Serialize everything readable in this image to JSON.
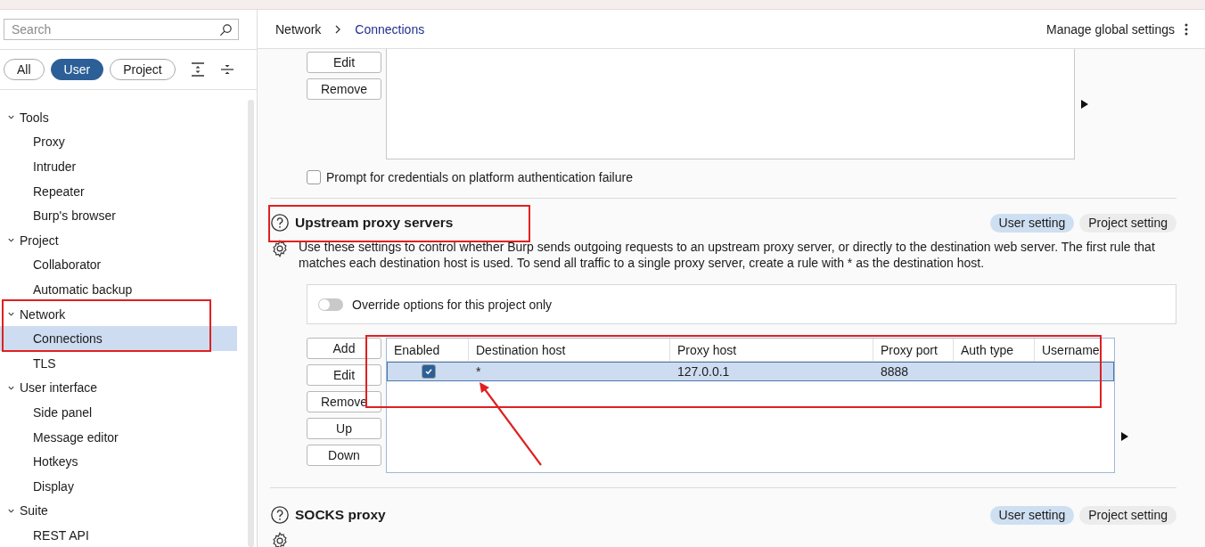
{
  "sidebar": {
    "search": {
      "placeholder": "Search"
    },
    "filters": [
      {
        "label": "All",
        "selected": false
      },
      {
        "label": "User",
        "selected": true
      },
      {
        "label": "Project",
        "selected": false
      }
    ],
    "tree": [
      {
        "label": "Tools",
        "expanded": true,
        "selected": false,
        "children": [
          {
            "label": "Proxy",
            "selected": false
          },
          {
            "label": "Intruder",
            "selected": false
          },
          {
            "label": "Repeater",
            "selected": false
          },
          {
            "label": "Burp's browser",
            "selected": false
          }
        ]
      },
      {
        "label": "Project",
        "expanded": true,
        "selected": false,
        "children": [
          {
            "label": "Collaborator",
            "selected": false
          },
          {
            "label": "Automatic backup",
            "selected": false
          }
        ]
      },
      {
        "label": "Network",
        "expanded": true,
        "selected": false,
        "children": [
          {
            "label": "Connections",
            "selected": true
          },
          {
            "label": "TLS",
            "selected": false
          }
        ]
      },
      {
        "label": "User interface",
        "expanded": true,
        "selected": false,
        "children": [
          {
            "label": "Side panel",
            "selected": false
          },
          {
            "label": "Message editor",
            "selected": false
          },
          {
            "label": "Hotkeys",
            "selected": false
          },
          {
            "label": "Display",
            "selected": false
          }
        ]
      },
      {
        "label": "Suite",
        "expanded": true,
        "selected": false,
        "children": [
          {
            "label": "REST API",
            "selected": false
          }
        ]
      }
    ]
  },
  "header": {
    "breadcrumb": [
      "Network",
      "Connections"
    ],
    "manage": "Manage global settings"
  },
  "auth_section": {
    "buttons": [
      "Edit",
      "Remove"
    ],
    "prompt": {
      "label": "Prompt for credentials on platform authentication failure",
      "checked": false
    }
  },
  "upstream": {
    "title": "Upstream proxy servers",
    "scopes": [
      {
        "label": "User setting",
        "selected": true
      },
      {
        "label": "Project setting",
        "selected": false
      }
    ],
    "description": "Use these settings to control whether Burp sends outgoing requests to an upstream proxy server, or directly to the destination web server. The first rule that matches each destination host is used. To send all traffic to a single proxy server, create a rule with * as the destination host.",
    "override": {
      "label": "Override options for this project only",
      "on": false
    },
    "buttons": [
      "Add",
      "Edit",
      "Remove",
      "Up",
      "Down"
    ],
    "table": {
      "columns": [
        "Enabled",
        "Destination host",
        "Proxy host",
        "Proxy port",
        "Auth type",
        "Username"
      ],
      "rows": [
        {
          "selected": true,
          "cells": [
            {
              "kind": "checkbox",
              "checked": true
            },
            {
              "kind": "text",
              "text": "*"
            },
            {
              "kind": "text",
              "text": "127.0.0.1"
            },
            {
              "kind": "text",
              "text": "8888"
            }
          ]
        }
      ]
    }
  },
  "socks": {
    "title": "SOCKS proxy",
    "scopes": [
      {
        "label": "User setting",
        "selected": true
      },
      {
        "label": "Project setting",
        "selected": false
      }
    ]
  }
}
